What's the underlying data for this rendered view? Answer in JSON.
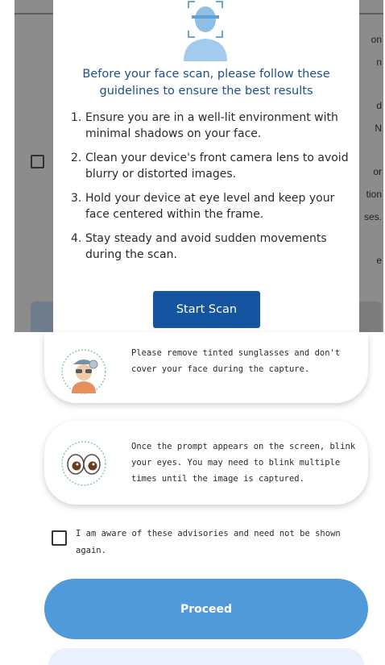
{
  "background_fragments": [
    "on",
    "n",
    "d",
    "N",
    "or",
    "tion",
    "ses.",
    "e"
  ],
  "modal": {
    "title_line1": "Before your face scan, please follow these",
    "title_line2": "guidelines to ensure the best results",
    "guidelines": [
      {
        "num": "1.",
        "text": "Ensure you are in a well-lit environment with minimal shadows on your face."
      },
      {
        "num": "2.",
        "text": "Clean your device's front camera lens to avoid blurry or distorted images."
      },
      {
        "num": "3.",
        "text": "Hold your device at eye level and keep your face centered within the frame."
      },
      {
        "num": "4.",
        "text": "Stay steady and avoid sudden movements during the scan."
      }
    ],
    "start_label": "Start Scan"
  },
  "advisories": [
    {
      "icon": "face-glasses-icon",
      "text": "Please remove tinted sunglasses and don't cover your face during the capture."
    },
    {
      "icon": "blinking-eyes-icon",
      "text": "Once the prompt appears on the screen, blink your eyes. You may need to blink multiple times until the image is captured."
    }
  ],
  "ack": {
    "label": "I am aware of these advisories and need not be shown again.",
    "checked": false
  },
  "proceed_label": "Proceed",
  "colors": {
    "accent": "#1554a0",
    "title": "#1e4f88",
    "proceed": "#509ad9",
    "scrim": "#8c8c8c"
  }
}
